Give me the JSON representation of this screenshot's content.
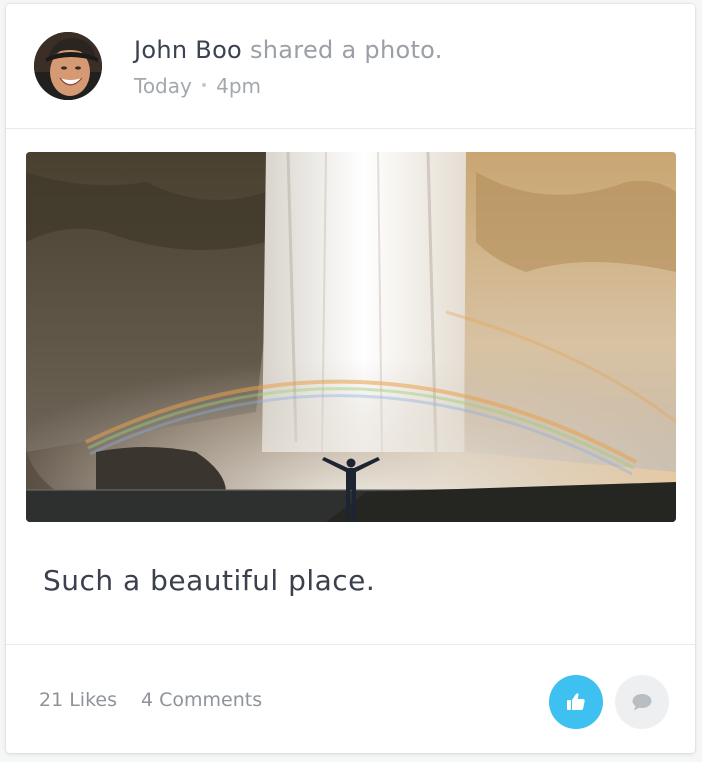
{
  "post": {
    "author": "John Boo",
    "action": "shared a photo.",
    "date": "Today",
    "separator": "•",
    "time": "4pm",
    "caption": "Such a beautiful place."
  },
  "stats": {
    "likes": "21 Likes",
    "comments": "4 Comments"
  },
  "buttons": {
    "like_icon": "thumbs-up-icon",
    "comment_icon": "speech-bubble-icon"
  },
  "colors": {
    "like_button": "#3ec1f0",
    "comment_button": "#edeff1",
    "text_primary": "#3b4250",
    "text_muted": "#9aa0a6"
  }
}
